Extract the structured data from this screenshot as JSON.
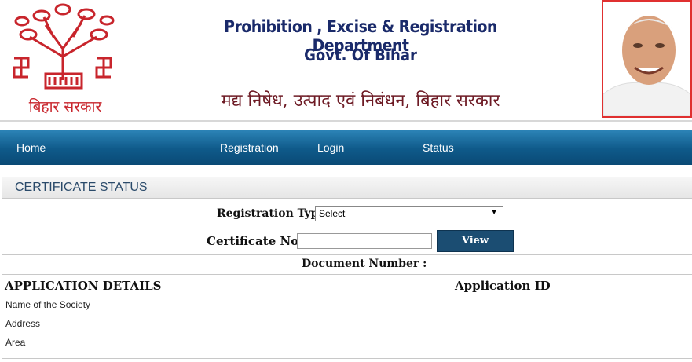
{
  "header": {
    "title_en": "Prohibition , Excise & Registration Department",
    "subtitle_en": "Govt. Of Bihar",
    "title_hi": "मद्य निषेध, उत्पाद एवं निबंधन, बिहार सरकार",
    "logo_text": "बिहार सरकार"
  },
  "nav": {
    "items": [
      "Home",
      "Registration",
      "Login",
      "Status"
    ]
  },
  "panel": {
    "title": "CERTIFICATE STATUS"
  },
  "form": {
    "registration_type_label": "Registration Type :",
    "registration_type_value": "Select",
    "certificate_no_label": "Certificate No :",
    "view_label": "View",
    "document_number_label": "Document Number :"
  },
  "details": {
    "heading": "APPLICATION DETAILS",
    "application_id_label": "Application ID",
    "fields": [
      "Name of the Society",
      "Address",
      "Area"
    ]
  },
  "colors": {
    "nav_gradient_top": "#2d85b8",
    "nav_gradient_bottom": "#0a4a75",
    "title_color": "#1a2a6a",
    "hindi_color": "#6d1a24",
    "button_bg": "#1b4d72"
  }
}
